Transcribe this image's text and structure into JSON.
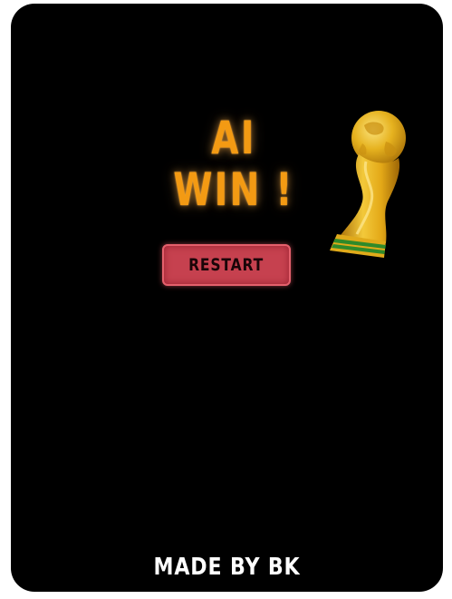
{
  "result": {
    "line1": "AI",
    "line2": "WIN !"
  },
  "restart_button": {
    "label": "RESTART"
  },
  "credit": "MADE BY BK",
  "trophy": {
    "icon": "world-cup-trophy-icon"
  },
  "colors": {
    "background": "#000000",
    "result_text": "#f39a13",
    "button": "#c6414f",
    "trophy_gold": "#e9b320",
    "trophy_band": "#2f8a2a"
  }
}
